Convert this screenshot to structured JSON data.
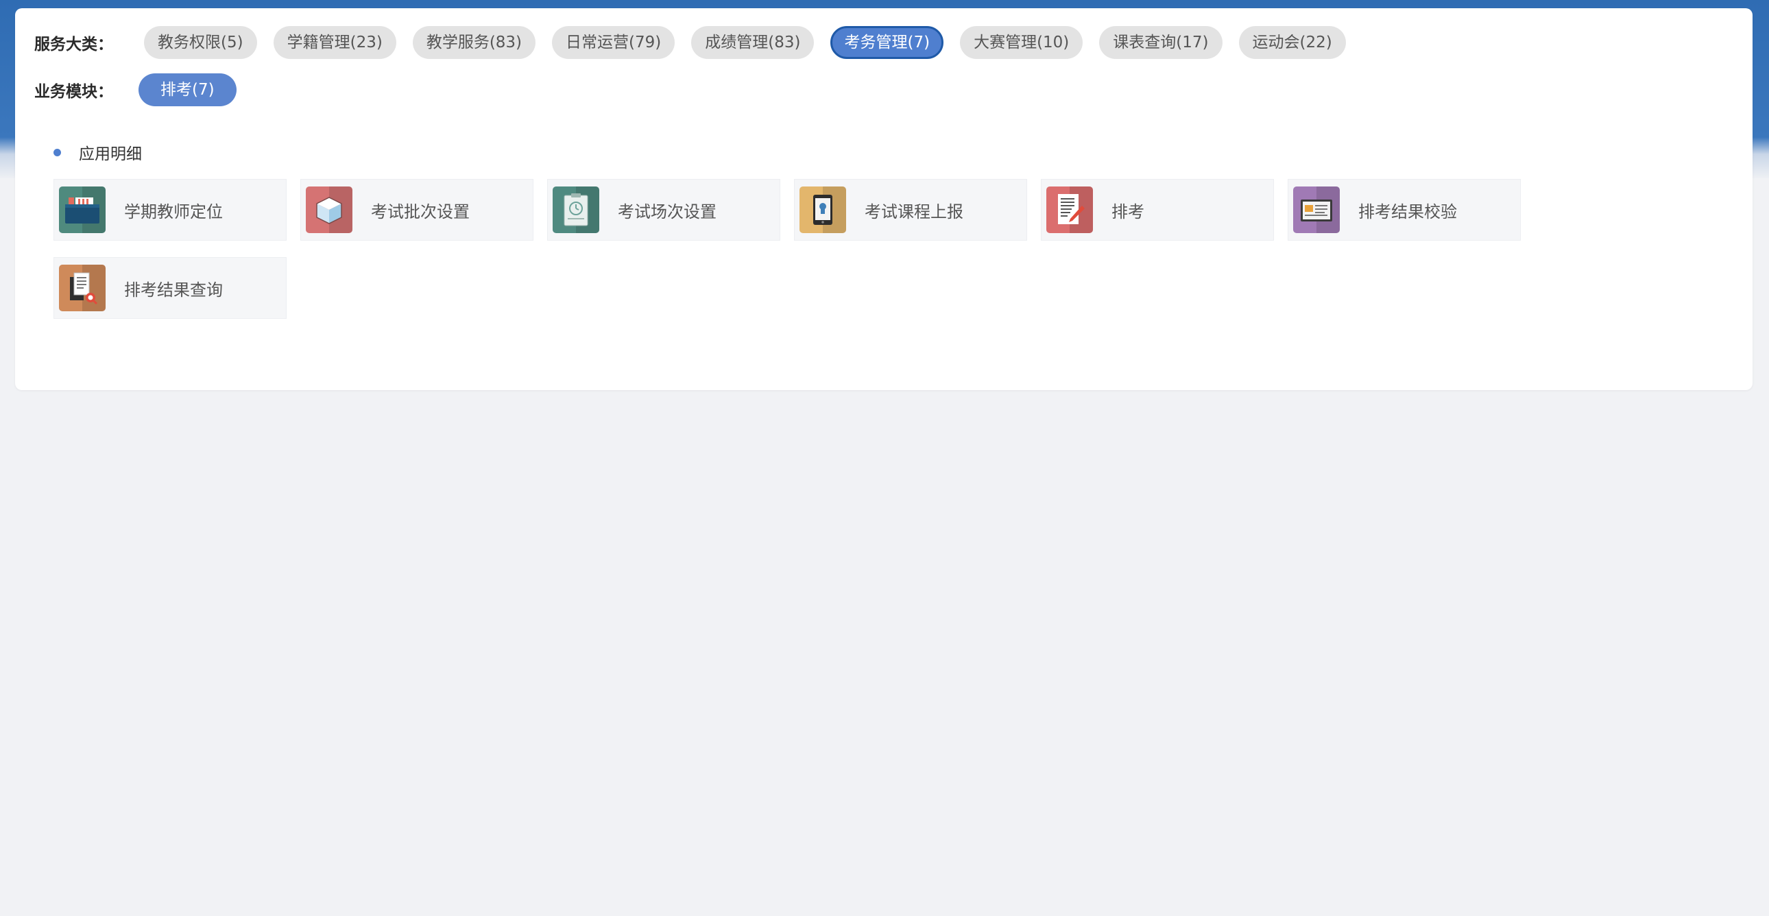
{
  "categories": {
    "label": "服务大类：",
    "items": [
      {
        "label": "教务权限(5)"
      },
      {
        "label": "学籍管理(23)"
      },
      {
        "label": "教学服务(83)"
      },
      {
        "label": "日常运营(79)"
      },
      {
        "label": "成绩管理(83)"
      },
      {
        "label": "考务管理(7)",
        "active": true
      },
      {
        "label": "大赛管理(10)"
      },
      {
        "label": "课表查询(17)"
      },
      {
        "label": "运动会(22)"
      }
    ]
  },
  "modules": {
    "label": "业务模块：",
    "items": [
      {
        "label": "排考(7)",
        "active": true
      }
    ]
  },
  "section": {
    "title": "应用明细"
  },
  "apps": [
    {
      "label": "学期教师定位",
      "icon": "folder-icon",
      "color": "#4f8a7e"
    },
    {
      "label": "考试批次设置",
      "icon": "cube-icon",
      "color": "#d57373"
    },
    {
      "label": "考试场次设置",
      "icon": "clipboard-clock-icon",
      "color": "#4f8a80"
    },
    {
      "label": "考试课程上报",
      "icon": "tablet-icon",
      "color": "#e3b66c"
    },
    {
      "label": "排考",
      "icon": "document-pen-icon",
      "color": "#db6e6e"
    },
    {
      "label": "排考结果校验",
      "icon": "screen-card-icon",
      "color": "#a07ab5"
    },
    {
      "label": "排考结果查询",
      "icon": "document-search-icon",
      "color": "#cf8a5a"
    }
  ],
  "colors": {
    "accent": "#4f7fcf",
    "header": "#2f6cb3",
    "active_border": "#1f5aa8"
  }
}
